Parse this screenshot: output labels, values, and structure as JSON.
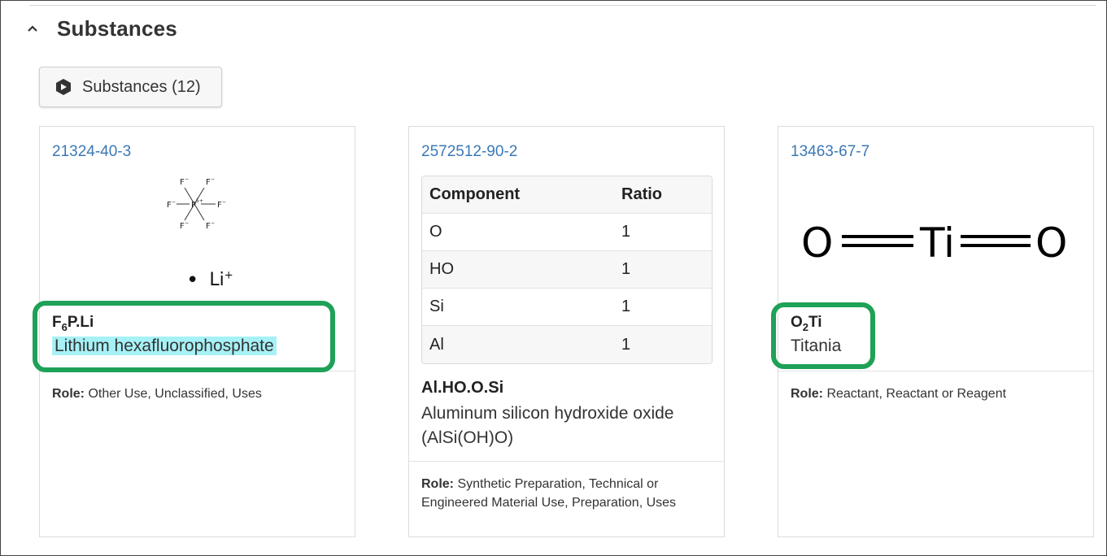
{
  "section": {
    "title": "Substances"
  },
  "substances_button": {
    "label": "Substances (12)"
  },
  "cards": [
    {
      "cas": "21324-40-3",
      "formula_prefix": "F",
      "formula_sub": "6",
      "formula_suffix": "P.Li",
      "name": "Lithium hexafluorophosphate",
      "role_label": "Role:",
      "role_text": "Other Use, Unclassified, Uses",
      "structure_counterion": "Li"
    },
    {
      "cas": "2572512-90-2",
      "table": {
        "headers": [
          "Component",
          "Ratio"
        ],
        "rows": [
          [
            "O",
            "1"
          ],
          [
            "HO",
            "1"
          ],
          [
            "Si",
            "1"
          ],
          [
            "Al",
            "1"
          ]
        ]
      },
      "formula": "Al.HO.O.Si",
      "name_line1": "Aluminum silicon hydroxide oxide",
      "name_line2": "(AlSi(OH)O)",
      "role_label": "Role:",
      "role_line1": "Synthetic Preparation, Technical or",
      "role_line2": "Engineered Material Use, Preparation, Uses"
    },
    {
      "cas": "13463-67-7",
      "formula_prefix": "O",
      "formula_sub": "2",
      "formula_suffix": "Ti",
      "name": "Titania",
      "role_label": "Role:",
      "role_text": "Reactant, Reactant or Reagent"
    }
  ],
  "colors": {
    "link": "#3b78b5",
    "highlight": "#a6f1f6",
    "annotation_box": "#1fa157"
  }
}
